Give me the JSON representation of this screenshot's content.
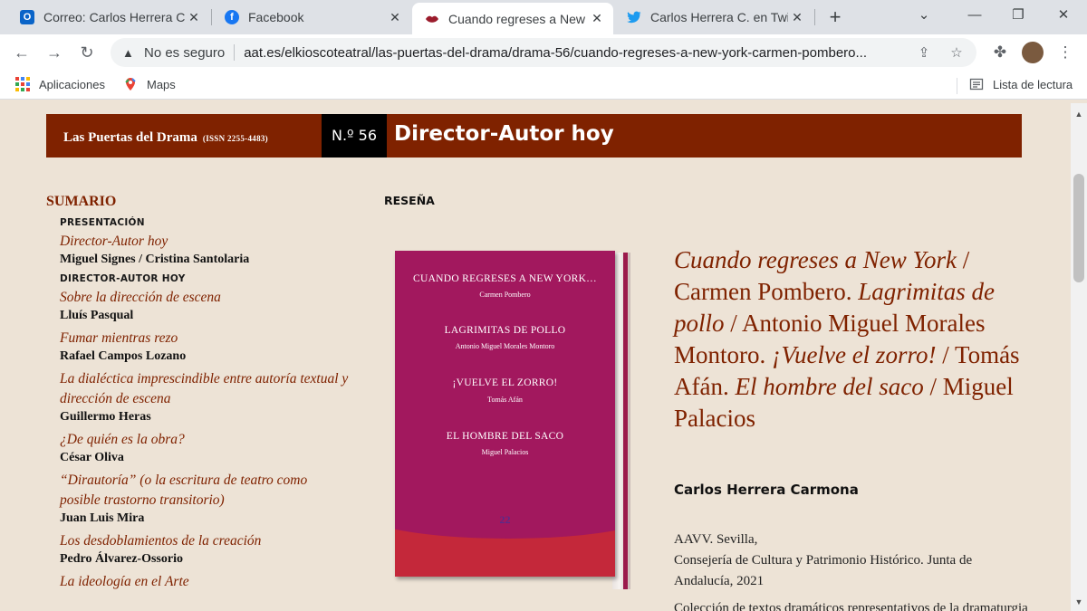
{
  "tabs": [
    {
      "title": "Correo: Carlos Herrera Ca",
      "favicon": "outlook-icon",
      "active": false
    },
    {
      "title": "Facebook",
      "favicon": "facebook-icon",
      "active": false
    },
    {
      "title": "Cuando regreses a New Y",
      "favicon": "site-lips-icon",
      "active": true
    },
    {
      "title": "Carlos Herrera C. en Twitt",
      "favicon": "twitter-icon",
      "active": false
    }
  ],
  "address_bar": {
    "security_label": "No es seguro",
    "url": "aat.es/elkioscoteatral/las-puertas-del-drama/drama-56/cuando-regreses-a-new-york-carmen-pombero..."
  },
  "bookmarks": {
    "apps": "Aplicaciones",
    "maps": "Maps",
    "reading_list": "Lista de lectura"
  },
  "banner": {
    "journal": "Las Puertas del Drama",
    "issn": "(ISSN 2255-4483)",
    "number": "N.º 56",
    "issue_title": "Director-Autor hoy"
  },
  "sumario": {
    "heading": "SUMARIO",
    "sections": [
      {
        "label": "PRESENTACIÓN",
        "items": [
          {
            "title": "Director-Autor hoy",
            "author": "Miguel Signes / Cristina Santolaria"
          }
        ]
      },
      {
        "label": "DIRECTOR-AUTOR HOY",
        "items": [
          {
            "title": "Sobre la dirección de escena",
            "author": "Lluís Pasqual"
          },
          {
            "title": "Fumar mientras rezo",
            "author": "Rafael Campos Lozano"
          },
          {
            "title": "La dialéctica imprescindible entre autoría textual y dirección de escena",
            "author": "Guillermo Heras"
          },
          {
            "title": "¿De quién es la obra?",
            "author": "César Oliva"
          },
          {
            "title": "“Dirautoría” (o la escritura de teatro como posible trastorno transitorio)",
            "author": "Juan Luis Mira"
          },
          {
            "title": "Los desdoblamientos de la creación",
            "author": "Pedro Álvarez-Ossorio"
          },
          {
            "title": "La ideología en el Arte",
            "author": ""
          }
        ]
      }
    ]
  },
  "review": {
    "section_label": "RESEÑA",
    "title_parts": [
      {
        "text": "Cuando regreses a New York",
        "italic": true
      },
      {
        "text": " / Carmen Pombero. ",
        "italic": false
      },
      {
        "text": "Lagrimitas de pollo",
        "italic": true
      },
      {
        "text": " / Antonio Miguel Morales Montoro. ",
        "italic": false
      },
      {
        "text": "¡Vuelve el zorro!",
        "italic": true
      },
      {
        "text": " / Tomás Afán. ",
        "italic": false
      },
      {
        "text": "El hombre del saco",
        "italic": true
      },
      {
        "text": " / Miguel Palacios",
        "italic": false
      }
    ],
    "reviewer": "Carlos Herrera Carmona",
    "pub_line1": "AAVV. Sevilla,",
    "pub_line2": "Consejería de Cultura y Patrimonio Histórico. Junta de Andalucía, 2021",
    "cut_text": "Colección de textos dramáticos representativos de la dramaturgia"
  },
  "book_cover": {
    "works": [
      {
        "title": "CUANDO REGRESES A NEW YORK…",
        "author": "Carmen Pombero"
      },
      {
        "title": "LAGRIMITAS DE POLLO",
        "author": "Antonio Miguel Morales Montoro"
      },
      {
        "title": "¡VUELVE EL ZORRO!",
        "author": "Tomás Afán"
      },
      {
        "title": "EL HOMBRE DEL SACO",
        "author": "Miguel Palacios"
      }
    ],
    "number": "22",
    "colors": {
      "cover": "#a2185e",
      "bottom": "#c4283a"
    }
  },
  "colors": {
    "banner": "#7f2200",
    "accent": "#7f2200",
    "page_bg": "#ede3d6"
  }
}
